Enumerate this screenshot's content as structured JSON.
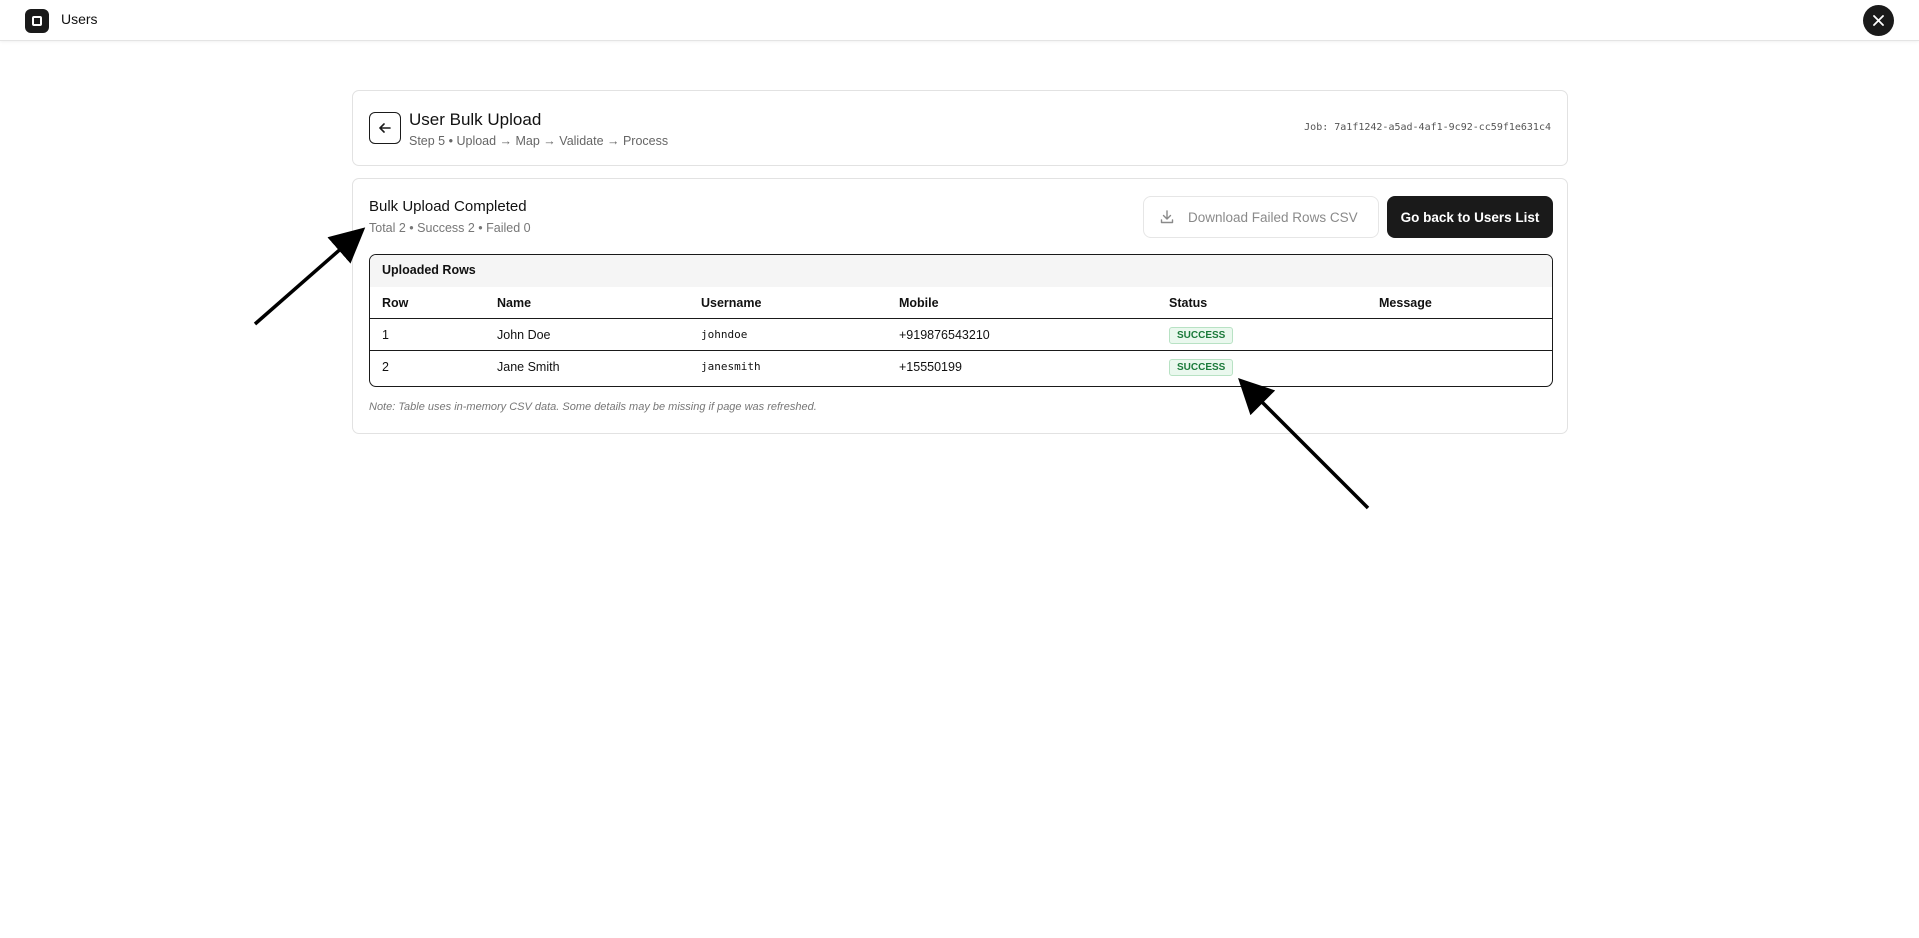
{
  "topbar": {
    "title": "Users",
    "logo_icon": "square-logo-icon",
    "close_icon": "close-icon"
  },
  "header": {
    "title": "User Bulk Upload",
    "steps": "Step 5 • Upload → Map → Validate → Process",
    "job": "Job: 7a1f1242-a5ad-4af1-9c92-cc59f1e631c4",
    "back_icon": "arrow-left-icon"
  },
  "result": {
    "title": "Bulk Upload Completed",
    "summary": "Total 2 • Success 2 • Failed 0",
    "download_label": "Download Failed Rows CSV",
    "download_icon": "download-icon",
    "goback_label": "Go back to Users List"
  },
  "table": {
    "caption": "Uploaded Rows",
    "columns": [
      "Row",
      "Name",
      "Username",
      "Mobile",
      "Status",
      "Message"
    ],
    "rows": [
      {
        "row": "1",
        "name": "John Doe",
        "username": "johndoe",
        "mobile": "+919876543210",
        "status": "SUCCESS",
        "message": ""
      },
      {
        "row": "2",
        "name": "Jane Smith",
        "username": "janesmith",
        "mobile": "+15550199",
        "status": "SUCCESS",
        "message": ""
      }
    ]
  },
  "note": "Note: Table uses in-memory CSV data. Some details may be missing if page was refreshed.",
  "colors": {
    "primary": "#1a1a1a",
    "success_text": "#1b7a3a",
    "success_bg": "#eaf8ee"
  }
}
